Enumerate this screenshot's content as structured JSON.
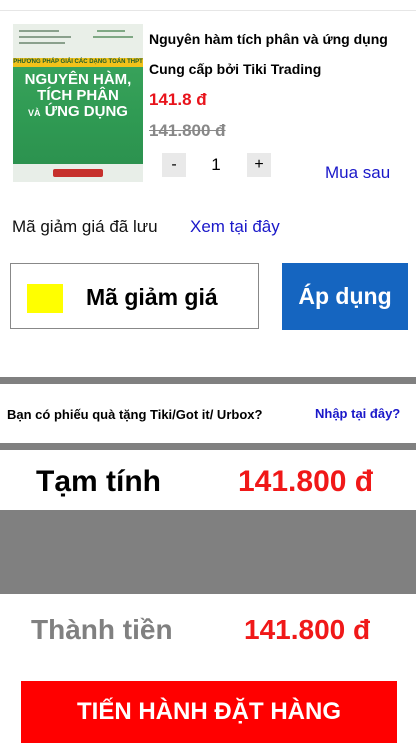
{
  "product": {
    "cover": {
      "ribbon": "PHƯƠNG PHÁP GIẢI CÁC DẠNG TOÁN THPT",
      "title_line1": "NGUYÊN HÀM,",
      "title_line2": "TÍCH PHÂN",
      "title_line3_small": "VÀ",
      "title_line3": " ỨNG DỤNG"
    },
    "title": "Nguyên hàm tích phân và ứng dụng",
    "seller": "Cung cấp bởi Tiki Trading",
    "price": "141.8 đ",
    "old_price": "141.800 đ",
    "quantity": {
      "minus": "-",
      "value": "1",
      "plus": "+"
    },
    "save_later": "Mua sau"
  },
  "coupon": {
    "saved_label": "Mã giảm giá đã lưu",
    "saved_link": "Xem tại đây",
    "placeholder": "Mã giảm giá",
    "apply_label": "Áp dụng",
    "swatch_color": "#ffff00"
  },
  "gift": {
    "question": "Bạn có phiếu quà tặng Tiki/Got it/ Urbox?",
    "link": "Nhập tại đây?"
  },
  "summary": {
    "subtotal_label": "Tạm tính",
    "subtotal_value": "141.800 đ",
    "total_label": "Thành tiền",
    "total_value": "141.800 đ"
  },
  "checkout": {
    "label": "TIẾN HÀNH ĐẶT HÀNG"
  },
  "colors": {
    "price_red": "#e8131b",
    "link_blue": "#1a18c9",
    "apply_blue": "#1565c0",
    "checkout_red": "#ff0000"
  }
}
